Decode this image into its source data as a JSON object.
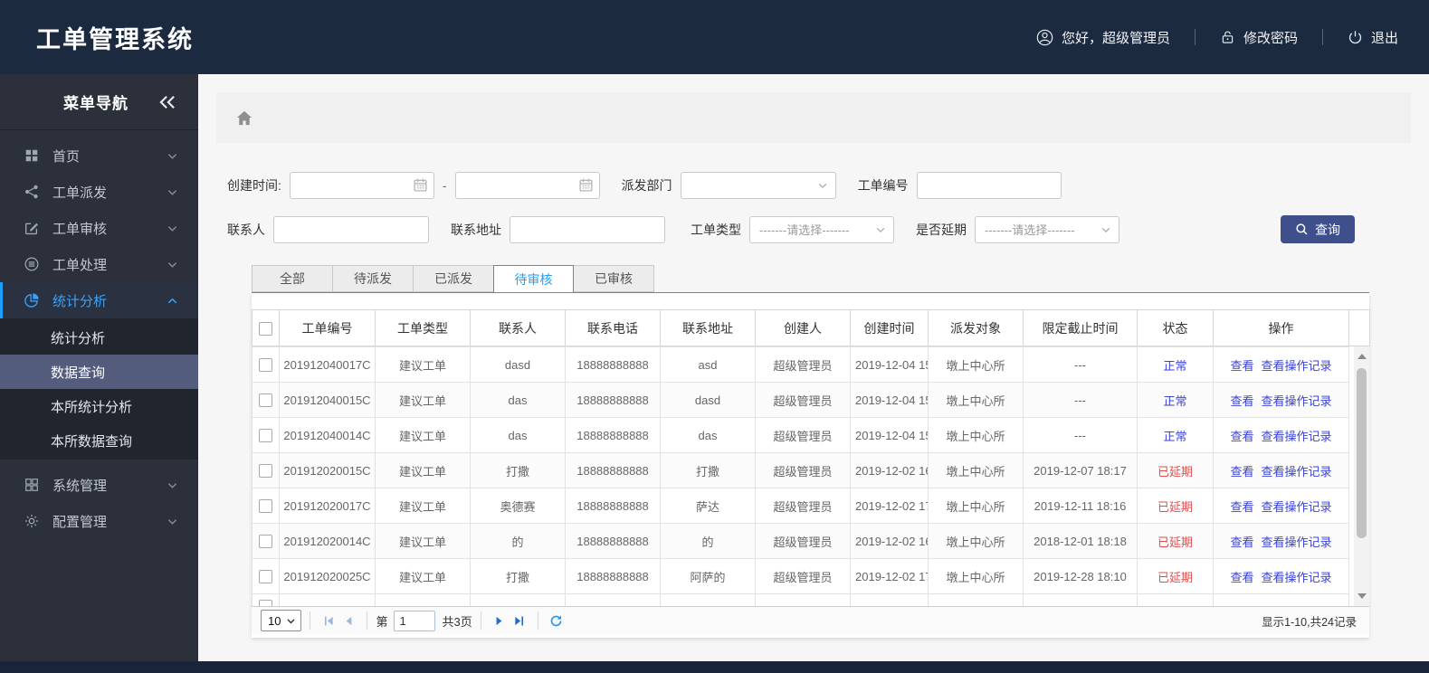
{
  "app": {
    "title": "工单管理系统"
  },
  "userbar": {
    "greeting": "您好，超级管理员",
    "change_password": "修改密码",
    "logout": "退出"
  },
  "sidebar": {
    "title": "菜单导航",
    "items": [
      {
        "label": "首页"
      },
      {
        "label": "工单派发"
      },
      {
        "label": "工单审核"
      },
      {
        "label": "工单处理"
      },
      {
        "label": "统计分析"
      },
      {
        "label": "系统管理"
      },
      {
        "label": "配置管理"
      }
    ],
    "submenu": [
      {
        "label": "统计分析"
      },
      {
        "label": "数据查询"
      },
      {
        "label": "本所统计分析"
      },
      {
        "label": "本所数据查询"
      }
    ]
  },
  "filters": {
    "created_label": "创建时间:",
    "range_separator": "-",
    "department_label": "派发部门",
    "order_no_label": "工单编号",
    "contact_label": "联系人",
    "address_label": "联系地址",
    "type_label": "工单类型",
    "type_placeholder": "-------请选择-------",
    "delay_label": "是否延期",
    "delay_placeholder": "-------请选择-------",
    "search_button": "查询"
  },
  "tabs": [
    {
      "label": "全部"
    },
    {
      "label": "待派发"
    },
    {
      "label": "已派发"
    },
    {
      "label": "待审核"
    },
    {
      "label": "已审核"
    }
  ],
  "table": {
    "columns": [
      "工单编号",
      "工单类型",
      "联系人",
      "联系电话",
      "联系地址",
      "创建人",
      "创建时间",
      "派发对象",
      "限定截止时间",
      "状态",
      "操作"
    ],
    "actions": [
      "查看",
      "查看操作记录"
    ],
    "rows": [
      {
        "order_no": "201912040017C",
        "type": "建议工单",
        "contact": "dasd",
        "phone": "18888888888",
        "address": "asd",
        "creator": "超级管理员",
        "created": "2019-12-04 15",
        "dispatch": "墩上中心所",
        "deadline": "---",
        "status": "正常",
        "status_type": "normal"
      },
      {
        "order_no": "201912040015C",
        "type": "建议工单",
        "contact": "das",
        "phone": "18888888888",
        "address": "dasd",
        "creator": "超级管理员",
        "created": "2019-12-04 15",
        "dispatch": "墩上中心所",
        "deadline": "---",
        "status": "正常",
        "status_type": "normal"
      },
      {
        "order_no": "201912040014C",
        "type": "建议工单",
        "contact": "das",
        "phone": "18888888888",
        "address": "das",
        "creator": "超级管理员",
        "created": "2019-12-04 15",
        "dispatch": "墩上中心所",
        "deadline": "---",
        "status": "正常",
        "status_type": "normal"
      },
      {
        "order_no": "201912020015C",
        "type": "建议工单",
        "contact": "打撒",
        "phone": "18888888888",
        "address": "打撒",
        "creator": "超级管理员",
        "created": "2019-12-02 16",
        "dispatch": "墩上中心所",
        "deadline": "2019-12-07 18:17",
        "status": "已延期",
        "status_type": "delayed"
      },
      {
        "order_no": "201912020017C",
        "type": "建议工单",
        "contact": "奥德赛",
        "phone": "18888888888",
        "address": "萨达",
        "creator": "超级管理员",
        "created": "2019-12-02 17",
        "dispatch": "墩上中心所",
        "deadline": "2019-12-11 18:16",
        "status": "已延期",
        "status_type": "delayed"
      },
      {
        "order_no": "201912020014C",
        "type": "建议工单",
        "contact": "的",
        "phone": "18888888888",
        "address": "的",
        "creator": "超级管理员",
        "created": "2019-12-02 16",
        "dispatch": "墩上中心所",
        "deadline": "2018-12-01 18:18",
        "status": "已延期",
        "status_type": "delayed"
      },
      {
        "order_no": "201912020025C",
        "type": "建议工单",
        "contact": "打撒",
        "phone": "18888888888",
        "address": "阿萨的",
        "creator": "超级管理员",
        "created": "2019-12-02 17",
        "dispatch": "墩上中心所",
        "deadline": "2019-12-28 18:10",
        "status": "已延期",
        "status_type": "delayed"
      }
    ]
  },
  "pagination": {
    "page_size": "10",
    "page_prefix": "第",
    "page_value": "1",
    "total_pages": "共3页",
    "summary": "显示1-10,共24记录"
  }
}
